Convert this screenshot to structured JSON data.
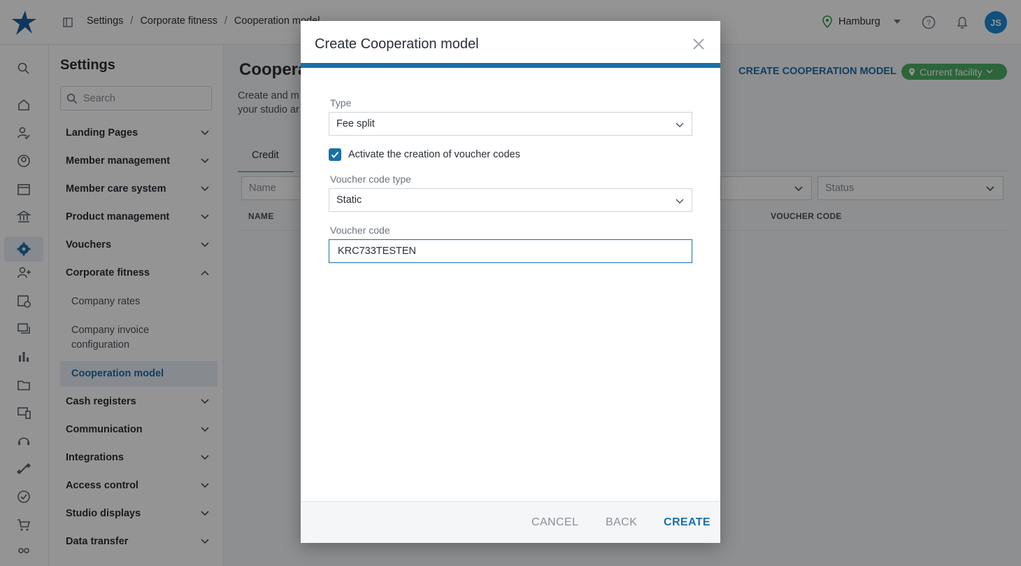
{
  "breadcrumb": [
    "Settings",
    "Corporate fitness",
    "Cooperation model"
  ],
  "header": {
    "location": "Hamburg",
    "avatar_initials": "JS"
  },
  "rail_icons": [
    "search-icon",
    "home-icon",
    "member-check-icon",
    "user-circle-icon",
    "calendar-icon",
    "bank-icon",
    "settings-icon",
    "add-user-icon",
    "calendar-clock-icon",
    "chat-icon",
    "bar-chart-icon",
    "folder-icon",
    "devices-icon",
    "support-icon",
    "dumbbell-icon",
    "check-circle-icon",
    "cart-icon",
    "people-icon"
  ],
  "settings": {
    "title": "Settings",
    "search_placeholder": "Search",
    "items": [
      {
        "label": "Landing Pages",
        "expanded": false
      },
      {
        "label": "Member management",
        "expanded": false
      },
      {
        "label": "Member care system",
        "expanded": false
      },
      {
        "label": "Product management",
        "expanded": false
      },
      {
        "label": "Vouchers",
        "expanded": false
      },
      {
        "label": "Corporate fitness",
        "expanded": true
      },
      {
        "label": "Cash registers",
        "expanded": false
      },
      {
        "label": "Communication",
        "expanded": false
      },
      {
        "label": "Integrations",
        "expanded": false
      },
      {
        "label": "Access control",
        "expanded": false
      },
      {
        "label": "Studio displays",
        "expanded": false
      },
      {
        "label": "Data transfer",
        "expanded": false
      }
    ],
    "sub_items": [
      "Company rates",
      "Company invoice configuration",
      "Cooperation model"
    ]
  },
  "main": {
    "title": "Coopera",
    "desc_line1": "Create and m",
    "desc_line2": "your studio ar",
    "create_button": "CREATE COOPERATION MODEL",
    "facility_chip": "Current facility",
    "tab": "Credit",
    "filter_name": "Name",
    "filter_status": "Status",
    "col_name": "NAME",
    "col_voucher": "VOUCHER CODE"
  },
  "modal": {
    "title": "Create Cooperation model",
    "type_label": "Type",
    "type_value": "Fee split",
    "checkbox_label": "Activate the creation of voucher codes",
    "checkbox_checked": true,
    "voucher_type_label": "Voucher code type",
    "voucher_type_value": "Static",
    "voucher_code_label": "Voucher code",
    "voucher_code_value": "KRC733TESTEN",
    "cancel": "CANCEL",
    "back": "BACK",
    "create": "CREATE"
  },
  "colors": {
    "accent": "#1b6fa8",
    "avatar": "#1b8bd8",
    "facility_chip": "#4caf65"
  }
}
